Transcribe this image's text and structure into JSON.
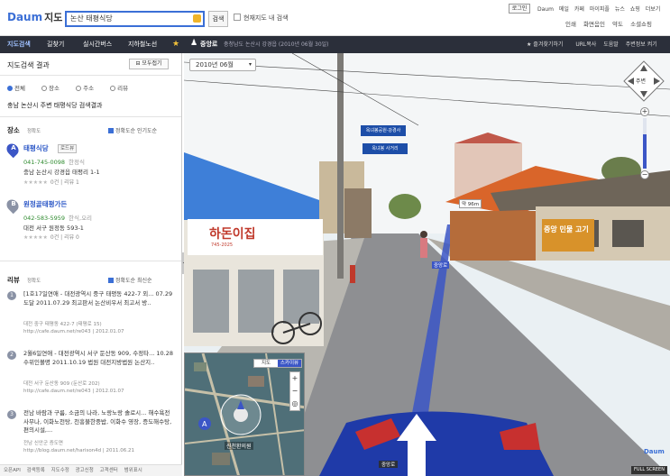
{
  "header": {
    "logo_main": "Daum",
    "logo_sub": "지도",
    "search_value": "논산 태평식당",
    "search_button": "검색",
    "current_map_label": "현재지도 내 검색",
    "login_button": "로그인",
    "top_links": [
      "Daum",
      "메일",
      "카페",
      "마이피플",
      "뉴스",
      "쇼핑",
      "더보기"
    ],
    "util_links": [
      "인쇄",
      "화면음인",
      "약도",
      "소셜쇼핑"
    ]
  },
  "nav": {
    "tabs": [
      "지도검색",
      "길찾기",
      "실시간버스",
      "지하철노선"
    ],
    "location": "중앙로",
    "address": "충청남도 논산시 강경읍 (2010년 06월 30일)",
    "right_links": [
      "즐겨찾기하기",
      "URL복사",
      "도움말",
      "주변정보 켜기"
    ]
  },
  "panel": {
    "title": "지도검색 결과",
    "collapse_button": "모두접기",
    "filters": [
      "전체",
      "장소",
      "주소",
      "리뷰"
    ],
    "summary": "충남 논산시 주변 태평식당 검색결과",
    "places_section": {
      "title": "장소",
      "sort": "정확도",
      "options": "정확도순   인기도순"
    },
    "places": [
      {
        "pin": "A",
        "name": "태평식당",
        "badge": "로드뷰",
        "phone": "041-745-0098",
        "tag": "한정식",
        "address": "충남 논산시 강경읍 태평리 1-1",
        "stars": "★★★★★",
        "count": "0건 | 리뷰 1"
      },
      {
        "pin": "B",
        "name": "원정골태평가든",
        "badge": "",
        "phone": "042-583-5959",
        "tag": "한식,오리",
        "address": "대전 서구 원정동 593-1",
        "stars": "★★★★★",
        "count": "0건 | 리뷰 0"
      }
    ],
    "reviews_section": {
      "title": "리뷰",
      "sort": "정확도",
      "options": "정확도순   최신순"
    },
    "reviews": [
      {
        "num": "1",
        "text": "[1호17일연애 - 대전광역시 중구 태평동 422-7 외... 07.29 도달 2011.07.29 최고판서 논산비우서 최고서 방..",
        "meta1": "대전 중구 태평동 422-7 (태평로 15)",
        "meta2": "http://cafe.daum.net/re043 | 2012.01.07"
      },
      {
        "num": "2",
        "text": "2월6일연애 - 대전광역시 서구 둔산동 909, 수정타... 10.28 수위인볼명 2011.10.19 법원 대전지방법원 논산지..",
        "meta1": "대전 서구 둔산동 909 (둔산로 202)",
        "meta2": "http://cafe.daum.net/re043 | 2012.01.07"
      },
      {
        "num": "3",
        "text": "전남 바람과 구름, 소금의 나라, 노랑노랑 솔로시... 해수욕전사무나, 이화노천탕, 천흥불한중밥, 이화수 영장, 증도해수탕, 편의시설,...",
        "meta1": "전남 신안군 증도면",
        "meta2": "http://blog.daum.net/harison4d | 2011.06.21"
      }
    ]
  },
  "footer": {
    "links": [
      "오픈API",
      "검색등록",
      "지도수정",
      "광고신청",
      "고객센터",
      "범위표시"
    ]
  },
  "roadview": {
    "date_select": "2010년 06월",
    "compass_label": "주변",
    "minimap_tabs": [
      "지도",
      "스카이뷰"
    ],
    "minimap_label": "신천환의원",
    "shop_sign": "하돈이집",
    "shop_sign_sub": "745-2025",
    "red_sign": "중앙 민물 고기",
    "sign_1": "옥녀봉공원·강경사",
    "sign_2": "옥녀봉 사거리",
    "distance_tag": "약 96m",
    "road_label": "중앙로",
    "bottom_loc": "중앙로",
    "daum_logo": "Daum",
    "fullscreen": "FULL SCREEN"
  },
  "colors": {
    "brand_blue": "#3b6fd6",
    "nav_dark": "#2b2f3a",
    "link_blue": "#2a56c6",
    "pin_blue": "#3b56c6"
  }
}
